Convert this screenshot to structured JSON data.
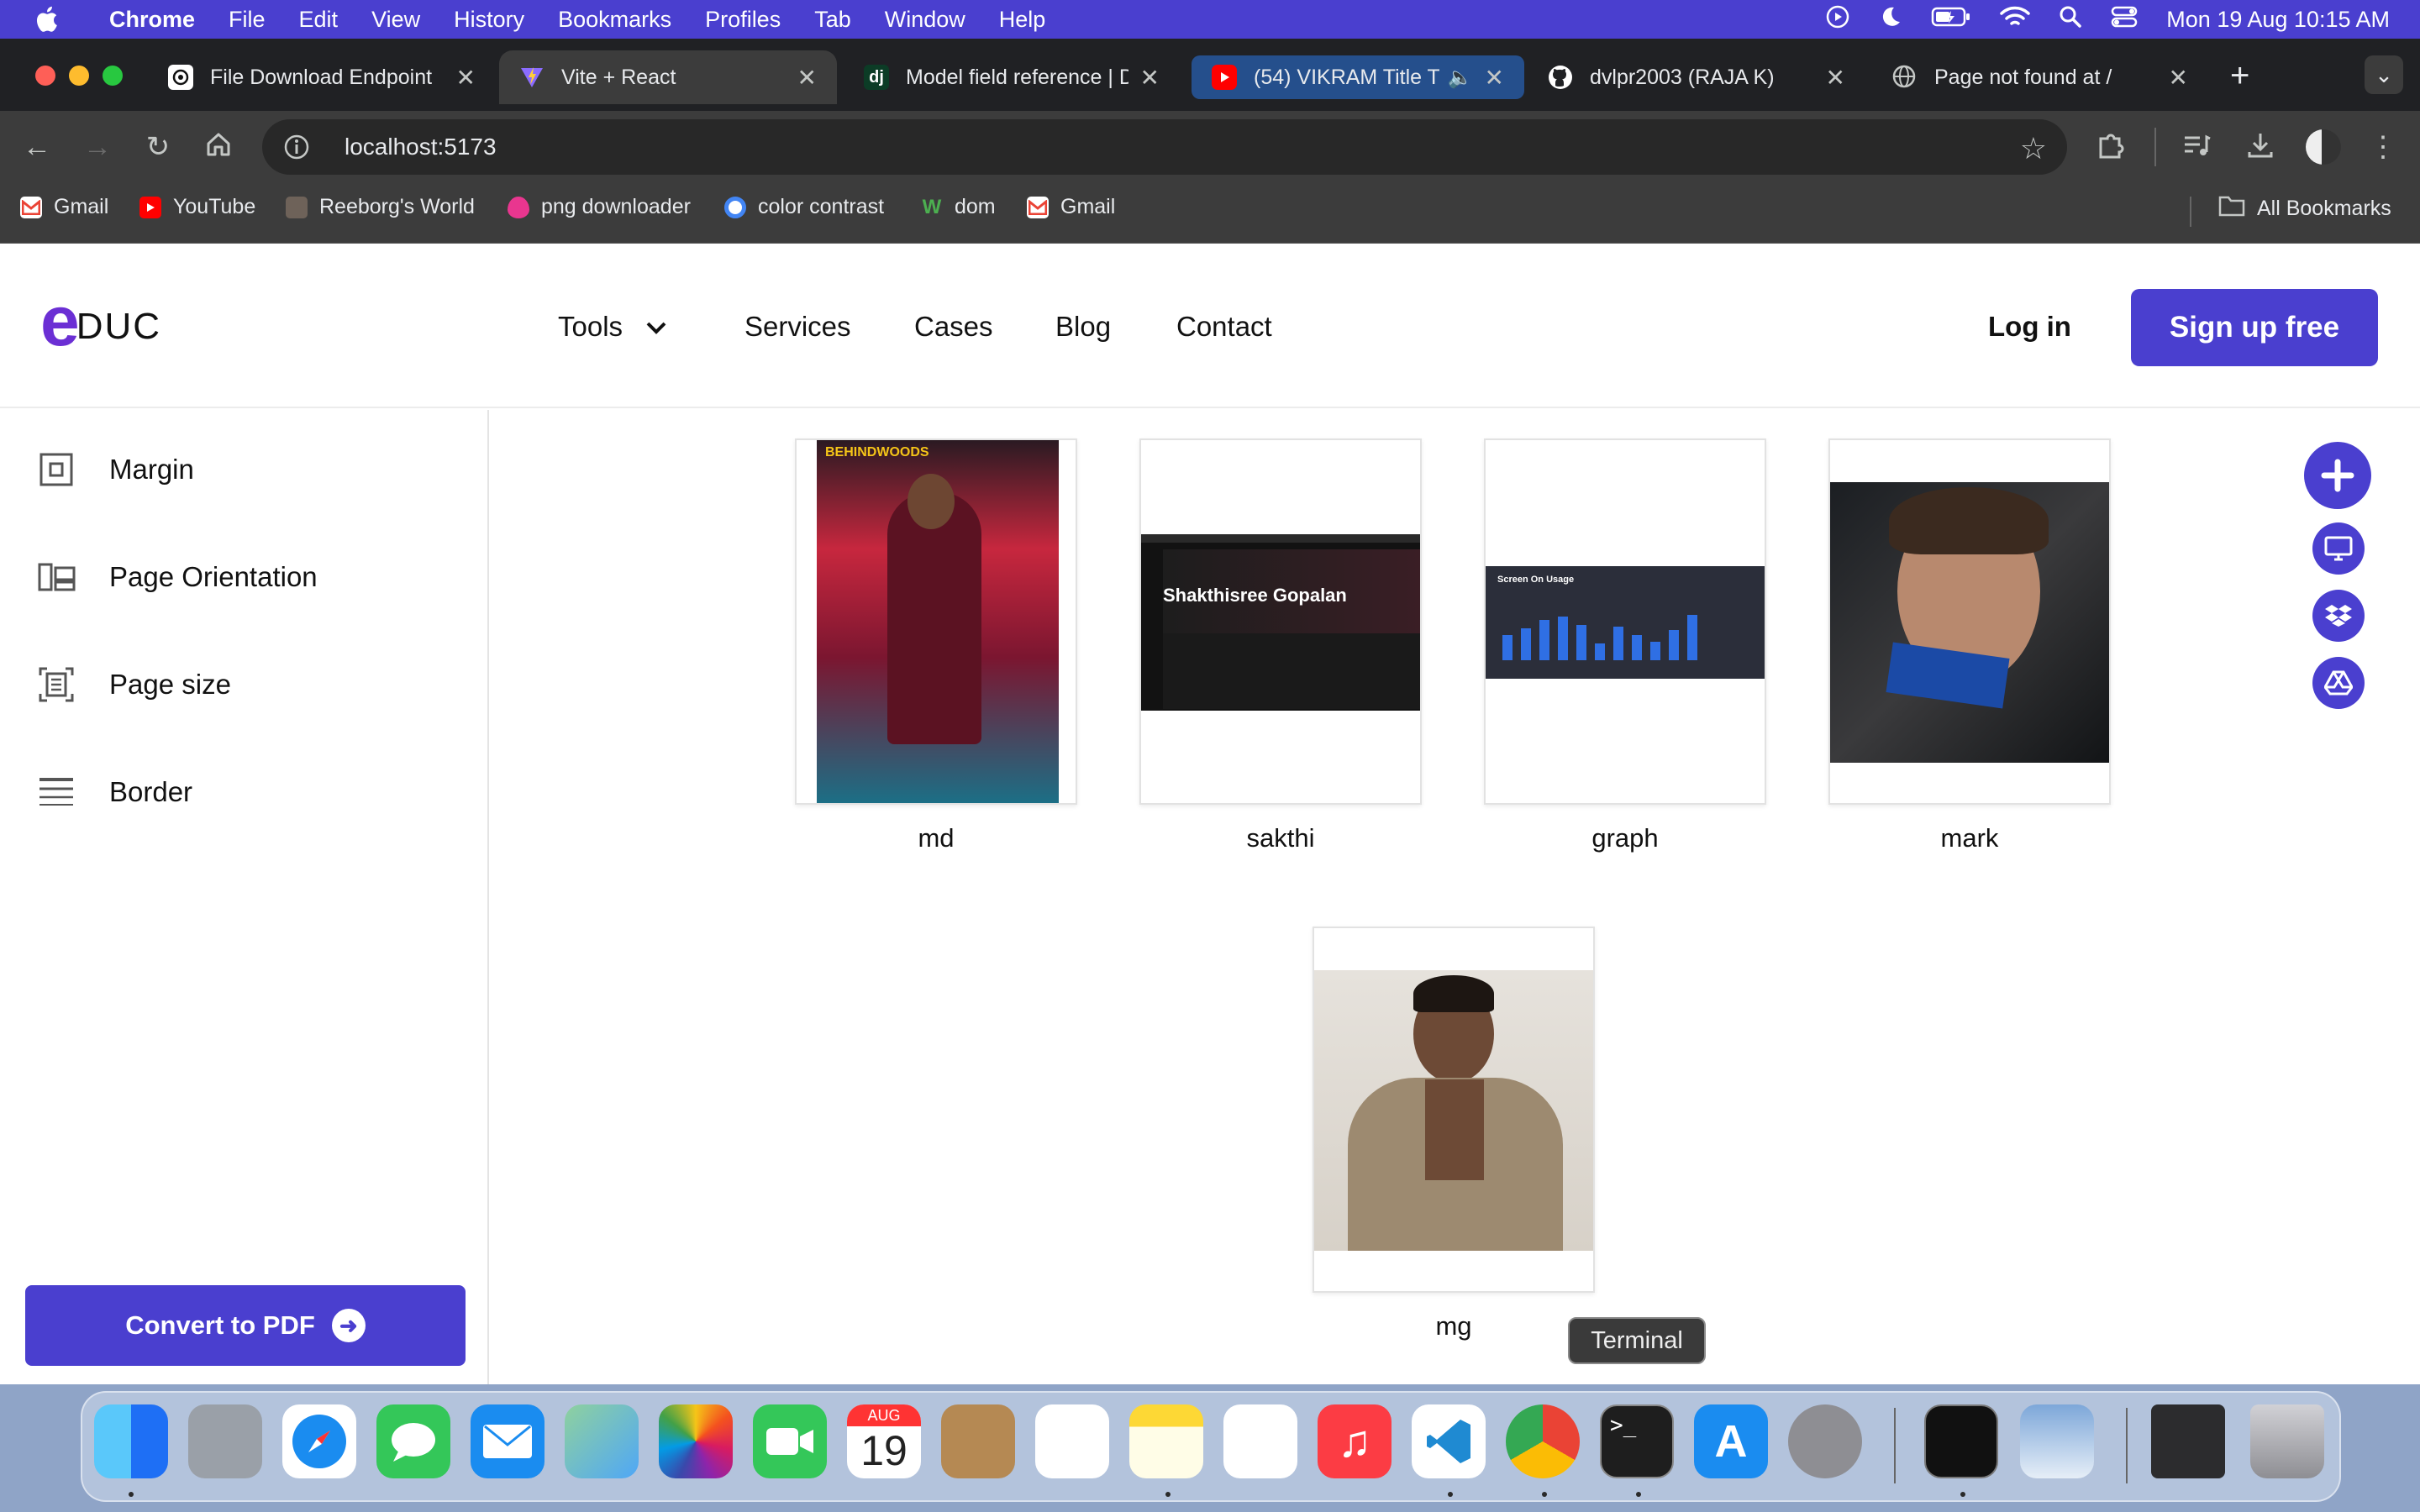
{
  "menubar": {
    "app_name": "Chrome",
    "items": [
      "File",
      "Edit",
      "View",
      "History",
      "Bookmarks",
      "Profiles",
      "Tab",
      "Window",
      "Help"
    ],
    "clock": "Mon 19 Aug  10:15 AM"
  },
  "tabs": [
    {
      "title": "File Download Endpoint",
      "icon": "openai-icon",
      "active": false
    },
    {
      "title": "Vite + React",
      "icon": "vite-icon",
      "active": true
    },
    {
      "title": "Model field reference | D",
      "icon": "django-icon",
      "active": false
    },
    {
      "title": "(54) VIKRAM Title T",
      "icon": "youtube-icon",
      "active": false
    },
    {
      "title": "dvlpr2003 (RAJA K)",
      "icon": "github-icon",
      "active": false
    },
    {
      "title": "Page not found at /",
      "icon": "globe-icon",
      "active": false
    }
  ],
  "address_bar": {
    "url": "localhost:5173"
  },
  "bookmarks": [
    {
      "label": "Gmail",
      "icon": "gmail-icon"
    },
    {
      "label": "YouTube",
      "icon": "youtube-icon"
    },
    {
      "label": "Reeborg's World",
      "icon": "robot-icon"
    },
    {
      "label": "png downloader",
      "icon": "pink-drop-icon"
    },
    {
      "label": "color contrast",
      "icon": "color-contrast-icon"
    },
    {
      "label": "dom",
      "icon": "w-icon"
    },
    {
      "label": "Gmail",
      "icon": "gmail-icon"
    }
  ],
  "all_bookmarks": "All Bookmarks",
  "site": {
    "logo_initial": "e",
    "logo_rest": "DUC",
    "nav": [
      "Tools",
      "Services",
      "Cases",
      "Blog",
      "Contact"
    ],
    "login": "Log in",
    "signup": "Sign up free",
    "brand_color": "#4a3fcf"
  },
  "sidebar": {
    "items": [
      {
        "label": "Margin",
        "icon": "margin-icon"
      },
      {
        "label": "Page Orientation",
        "icon": "orientation-icon"
      },
      {
        "label": "Page size",
        "icon": "page-size-icon"
      },
      {
        "label": "Border",
        "icon": "border-icon"
      }
    ],
    "convert_label": "Convert to PDF"
  },
  "images": [
    {
      "name": "md"
    },
    {
      "name": "sakthi",
      "thumb_title": "Shakthisree Gopalan"
    },
    {
      "name": "graph",
      "thumb_title": "Screen On Usage"
    },
    {
      "name": "mark"
    },
    {
      "name": "mg"
    }
  ],
  "tooltip": "Terminal",
  "dock": {
    "calendar_month": "AUG",
    "calendar_day": "19"
  }
}
